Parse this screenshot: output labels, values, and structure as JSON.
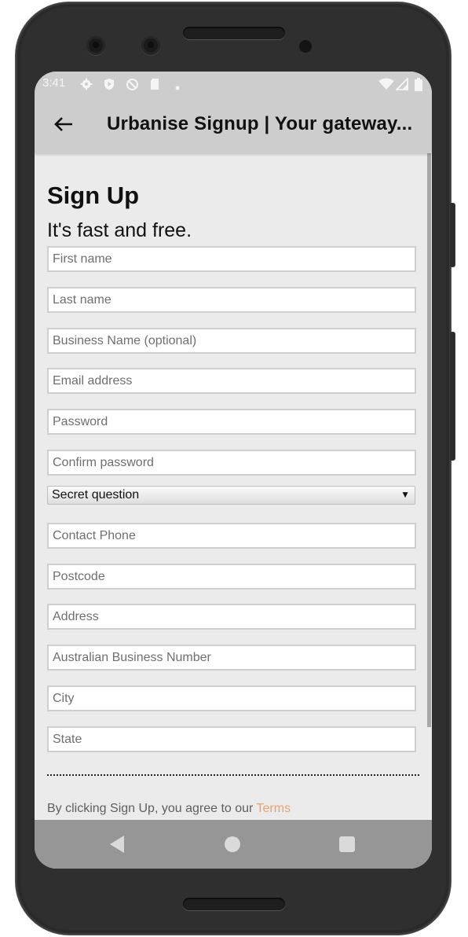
{
  "status_bar": {
    "time": "3:41",
    "left_icons": [
      "gear-icon",
      "shield-play-icon",
      "do-not-disturb-icon",
      "sd-card-icon",
      "dot-icon"
    ],
    "right_icons": [
      "wifi-icon",
      "cellular-signal-icon",
      "battery-icon"
    ]
  },
  "app_bar": {
    "back_icon": "arrow-left-icon",
    "title": "Urbanise Signup | Your gateway..."
  },
  "form": {
    "heading": "Sign Up",
    "subheading": "It's fast and free.",
    "fields": [
      {
        "name": "first-name",
        "placeholder": "First name",
        "value": ""
      },
      {
        "name": "last-name",
        "placeholder": "Last name",
        "value": ""
      },
      {
        "name": "business-name",
        "placeholder": "Business Name (optional)",
        "value": ""
      },
      {
        "name": "email",
        "placeholder": "Email address",
        "value": ""
      },
      {
        "name": "password",
        "placeholder": "Password",
        "value": ""
      },
      {
        "name": "confirm-password",
        "placeholder": "Confirm password",
        "value": ""
      }
    ],
    "secret_question": {
      "selected": "Secret question",
      "arrow": "▼"
    },
    "fields2": [
      {
        "name": "contact-phone",
        "placeholder": "Contact Phone",
        "value": ""
      },
      {
        "name": "postcode",
        "placeholder": "Postcode",
        "value": ""
      },
      {
        "name": "address",
        "placeholder": "Address",
        "value": ""
      },
      {
        "name": "abn",
        "placeholder": "Australian Business Number",
        "value": ""
      },
      {
        "name": "city",
        "placeholder": "City",
        "value": ""
      },
      {
        "name": "state",
        "placeholder": "State",
        "value": ""
      }
    ],
    "terms_text": "By clicking Sign Up, you agree to our ",
    "terms_link": "Terms",
    "terms_link_color": "#e3a477"
  },
  "nav_bar": {
    "back": "nav-back-icon",
    "home": "nav-home-icon",
    "recents": "nav-recents-icon"
  }
}
